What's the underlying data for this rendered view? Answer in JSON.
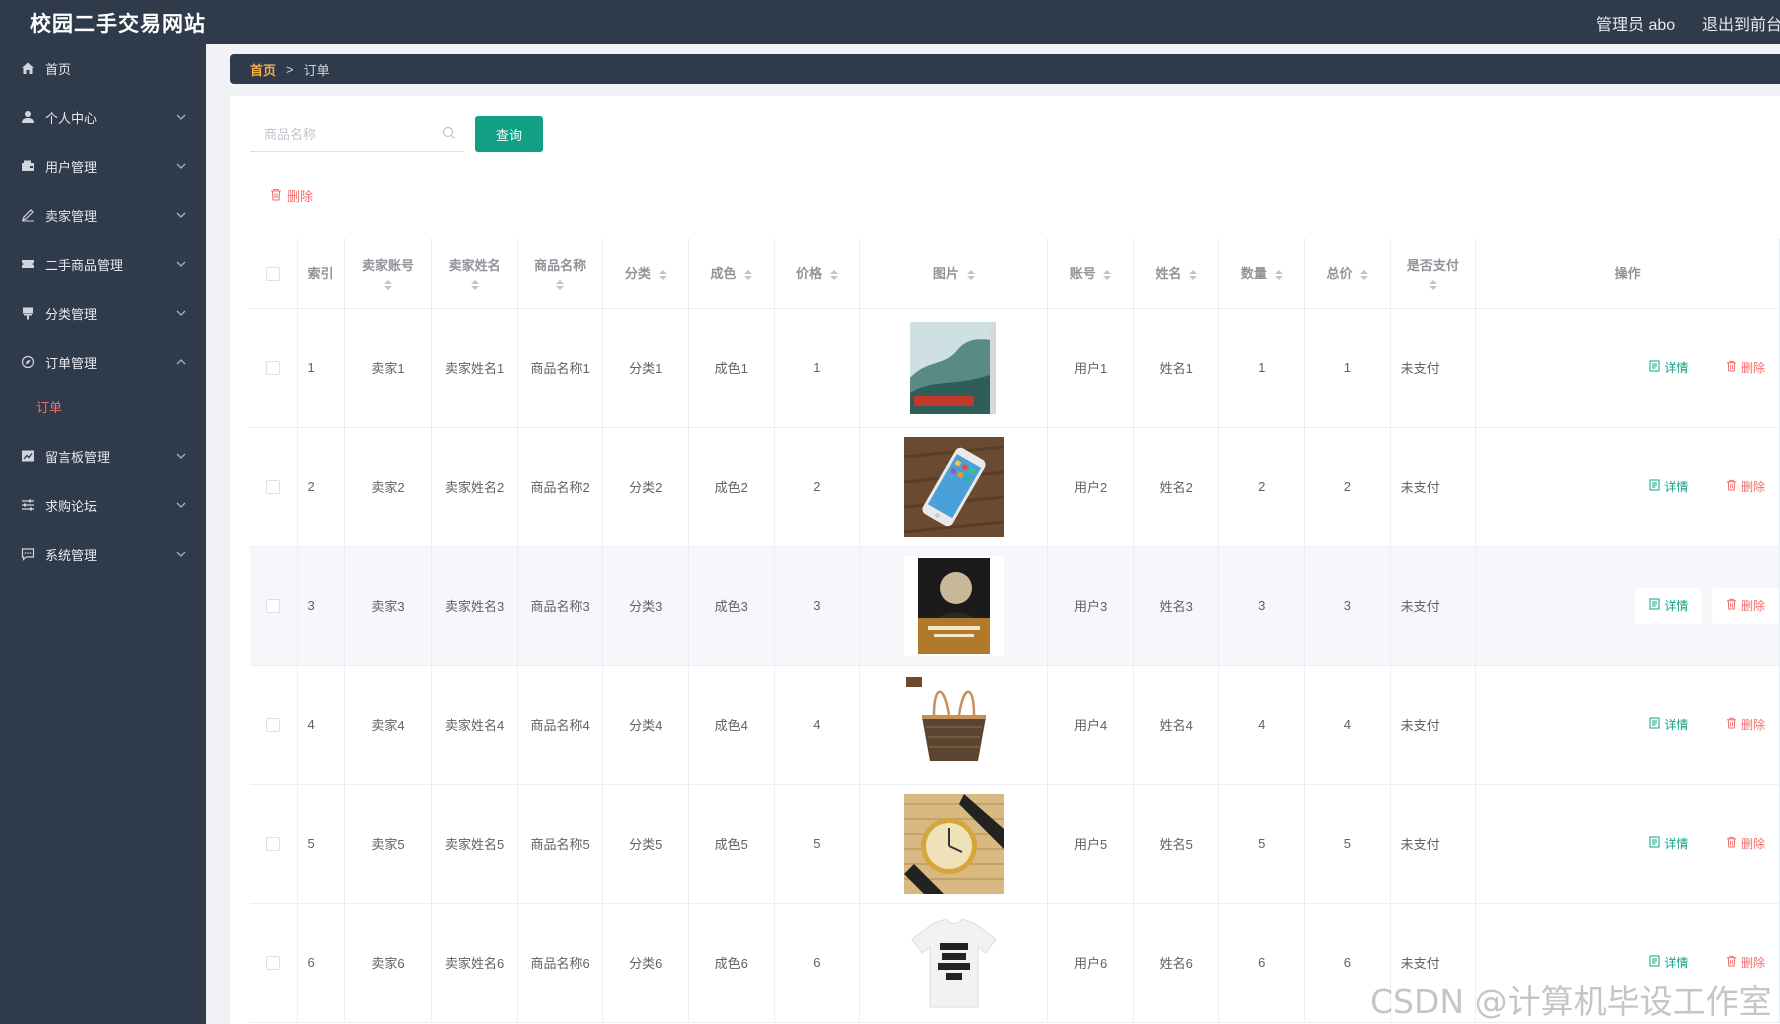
{
  "header": {
    "site_title": "校园二手交易网站",
    "user_label": "管理员 abo",
    "exit_label": "退出到前台"
  },
  "sidebar": {
    "items": [
      {
        "label": "首页",
        "icon": "home-icon",
        "expandable": false
      },
      {
        "label": "个人中心",
        "icon": "user-icon",
        "expandable": true
      },
      {
        "label": "用户管理",
        "icon": "wallet-icon",
        "expandable": true
      },
      {
        "label": "卖家管理",
        "icon": "pen-icon",
        "expandable": true
      },
      {
        "label": "二手商品管理",
        "icon": "ticket-icon",
        "expandable": true
      },
      {
        "label": "分类管理",
        "icon": "flag-icon",
        "expandable": true
      },
      {
        "label": "订单管理",
        "icon": "compass-icon",
        "expandable": true,
        "expanded": true
      },
      {
        "label": "留言板管理",
        "icon": "chart-icon",
        "expandable": true
      },
      {
        "label": "求购论坛",
        "icon": "sliders-icon",
        "expandable": true
      },
      {
        "label": "系统管理",
        "icon": "message-icon",
        "expandable": true
      }
    ],
    "active_submenu": "订单"
  },
  "breadcrumb": {
    "home": "首页",
    "separator": ">",
    "current": "订单"
  },
  "search": {
    "placeholder": "商品名称",
    "query_label": "查询",
    "delete_label": "删除"
  },
  "table": {
    "headers": [
      "索引",
      "卖家账号",
      "卖家姓名",
      "商品名称",
      "分类",
      "成色",
      "价格",
      "图片",
      "账号",
      "姓名",
      "数量",
      "总价",
      "是否支付",
      "操作"
    ],
    "detail_label": "详情",
    "delete_label": "删除",
    "rows": [
      {
        "index": "1",
        "seller_account": "卖家1",
        "seller_name": "卖家姓名1",
        "product": "商品名称1",
        "category": "分类1",
        "condition": "成色1",
        "price": "1",
        "image": "book-jade-cover",
        "account": "用户1",
        "name": "姓名1",
        "qty": "1",
        "total": "1",
        "paid": "未支付"
      },
      {
        "index": "2",
        "seller_account": "卖家2",
        "seller_name": "卖家姓名2",
        "product": "商品名称2",
        "category": "分类2",
        "condition": "成色2",
        "price": "2",
        "image": "phone-on-wood",
        "account": "用户2",
        "name": "姓名2",
        "qty": "2",
        "total": "2",
        "paid": "未支付"
      },
      {
        "index": "3",
        "seller_account": "卖家3",
        "seller_name": "卖家姓名3",
        "product": "商品名称3",
        "category": "分类3",
        "condition": "成色3",
        "price": "3",
        "image": "book-portrait-cover",
        "account": "用户3",
        "name": "姓名3",
        "qty": "3",
        "total": "3",
        "paid": "未支付"
      },
      {
        "index": "4",
        "seller_account": "卖家4",
        "seller_name": "卖家姓名4",
        "product": "商品名称4",
        "category": "分类4",
        "condition": "成色4",
        "price": "4",
        "image": "handbag",
        "account": "用户4",
        "name": "姓名4",
        "qty": "4",
        "total": "4",
        "paid": "未支付"
      },
      {
        "index": "5",
        "seller_account": "卖家5",
        "seller_name": "卖家姓名5",
        "product": "商品名称5",
        "category": "分类5",
        "condition": "成色5",
        "price": "5",
        "image": "wristwatch",
        "account": "用户5",
        "name": "姓名5",
        "qty": "5",
        "total": "5",
        "paid": "未支付"
      },
      {
        "index": "6",
        "seller_account": "卖家6",
        "seller_name": "卖家姓名6",
        "product": "商品名称6",
        "category": "分类6",
        "condition": "成色6",
        "price": "6",
        "image": "tshirt",
        "account": "用户6",
        "name": "姓名6",
        "qty": "6",
        "total": "6",
        "paid": "未支付"
      }
    ]
  },
  "watermark": "CSDN @计算机毕设工作室",
  "colors": {
    "sidebar_bg": "#2f3a4b",
    "accent_green": "#12a085",
    "danger_red": "#f56c6c",
    "breadcrumb_home": "#f0ad4e"
  }
}
